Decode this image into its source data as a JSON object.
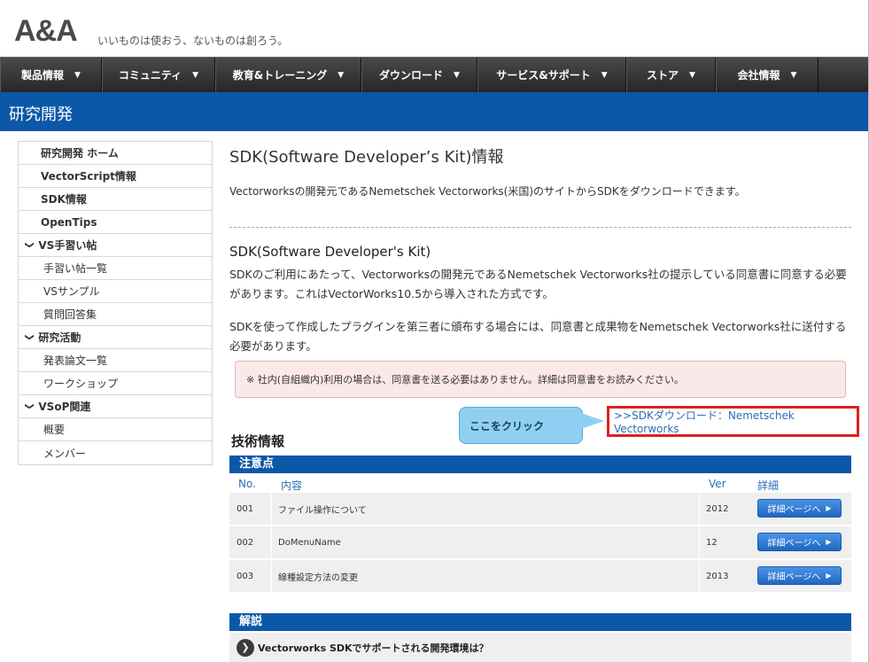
{
  "header": {
    "logo": "A&A",
    "tagline": "いいものは使おう、ないものは創ろう。"
  },
  "nav": {
    "items": [
      {
        "label": "製品情報"
      },
      {
        "label": "コミュニティ"
      },
      {
        "label": "教育&トレーニング"
      },
      {
        "label": "ダウンロード"
      },
      {
        "label": "サービス&サポート"
      },
      {
        "label": "ストア"
      },
      {
        "label": "会社情報"
      }
    ],
    "caret": "▼"
  },
  "band": {
    "title": "研究開発"
  },
  "sidebar": {
    "items": [
      {
        "label": "研究開発 ホーム"
      },
      {
        "label": "VectorScript情報"
      },
      {
        "label": "SDK情報"
      },
      {
        "label": "OpenTips"
      },
      {
        "label": "VS手習い帖"
      },
      {
        "label": "手習い帖一覧"
      },
      {
        "label": "VSサンプル"
      },
      {
        "label": "質問回答集"
      },
      {
        "label": "研究活動"
      },
      {
        "label": "発表論文一覧"
      },
      {
        "label": "ワークショップ"
      },
      {
        "label": "VSoP関連"
      },
      {
        "label": "概要"
      },
      {
        "label": "メンバー"
      }
    ],
    "chevron": "❯"
  },
  "main": {
    "title": "SDK(Software Developer’s Kit)情報",
    "intro": "Vectorworksの開発元であるNemetschek Vectorworks(米国)のサイトからSDKをダウンロードできます。",
    "sdk_heading": "SDK(Software Developer's Kit)",
    "para1": "SDKのご利用にあたって、Vectorworksの開発元であるNemetschek Vectorworks社の提示している同意書に同意する必要があります。これはVectorWorks10.5から導入された方式です。",
    "para2": "SDKを使って作成したプラグインを第三者に頒布する場合には、同意書と成果物をNemetschek Vectorworks社に送付する必要があります。",
    "note": "※ 社内(自組織内)利用の場合は、同意書を送る必要はありません。詳細は同意書をお読みください。",
    "callout": "ここをクリック",
    "download_link": ">>SDKダウンロード：Nemetschek Vectorworks",
    "tech_heading": "技術情報",
    "notes_section": "注意点",
    "columns": {
      "no": "No.",
      "content": "内容",
      "ver": "Ver",
      "detail": "詳細"
    },
    "rows": [
      {
        "no": "001",
        "content": "ファイル操作について",
        "ver": "2012",
        "button": "詳細ページへ"
      },
      {
        "no": "002",
        "content": "DoMenuName",
        "ver": "12",
        "button": "詳細ページへ"
      },
      {
        "no": "003",
        "content": "線種設定方法の変更",
        "ver": "2013",
        "button": "詳細ページへ"
      }
    ],
    "explain_section": "解説",
    "faq": "Vectorworks SDKでサポートされる開発環境は？"
  }
}
